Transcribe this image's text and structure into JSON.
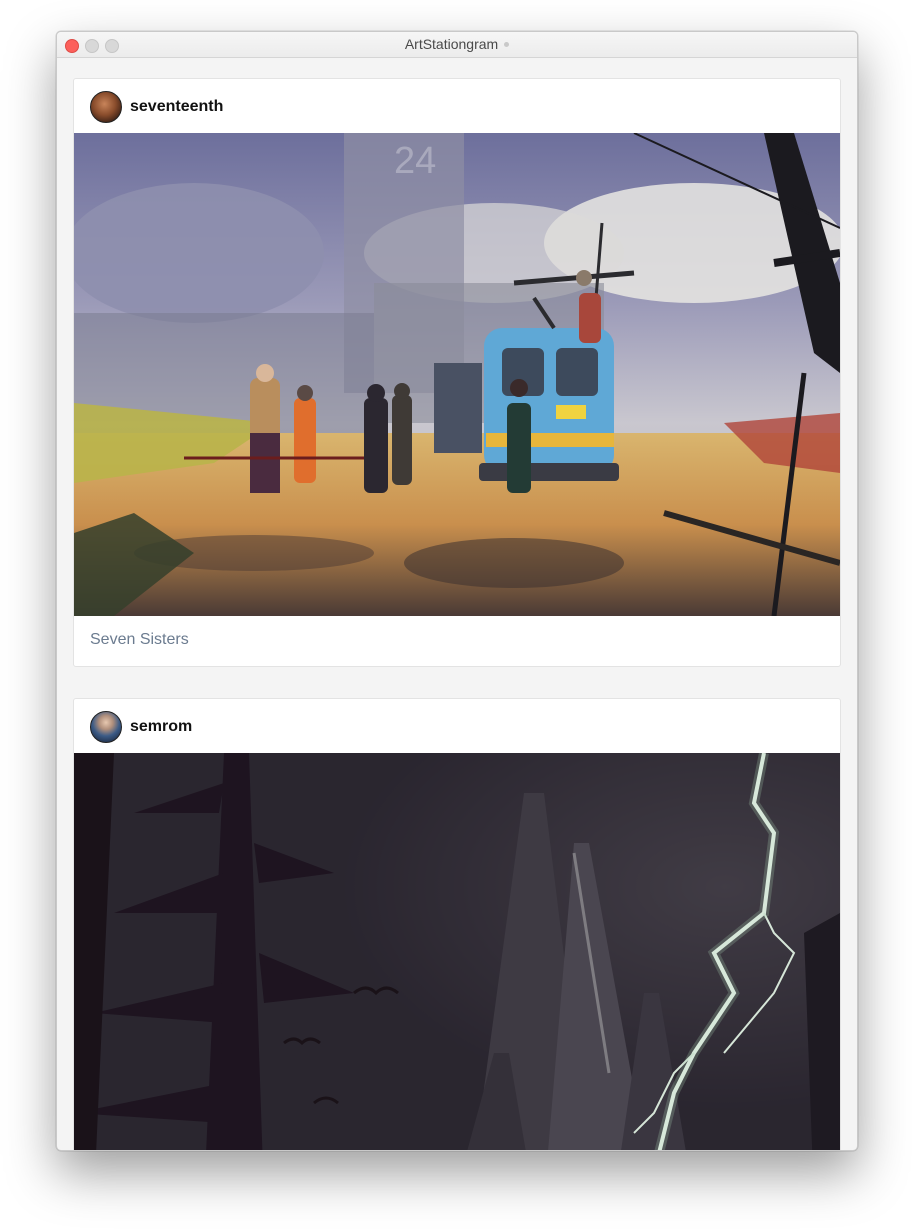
{
  "window": {
    "title": "ArtStationgram"
  },
  "posts": [
    {
      "username": "seventeenth",
      "caption": "Seven Sisters"
    },
    {
      "username": "semrom",
      "caption": ""
    }
  ],
  "colors": {
    "close_light": "#fc605b",
    "caption_text": "#6b7b8f"
  }
}
